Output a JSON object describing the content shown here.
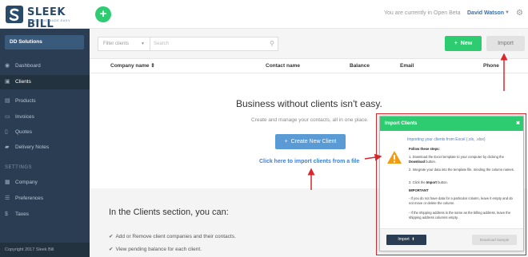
{
  "app": {
    "logo_text": "SLEEK BILL",
    "logo_tagline": "INVOICING MADE EASY",
    "beta_text": "You are currently in Open Beta",
    "user_name": "David Watson"
  },
  "sidebar": {
    "org_name": "DD Solutions",
    "items": [
      {
        "label": "Dashboard",
        "icon": "eye-icon",
        "active": false
      },
      {
        "label": "Clients",
        "icon": "clients-icon",
        "active": true
      },
      {
        "label": "Products",
        "icon": "box-icon",
        "active": false
      },
      {
        "label": "Invoices",
        "icon": "invoice-icon",
        "active": false
      },
      {
        "label": "Quotes",
        "icon": "quote-icon",
        "active": false
      },
      {
        "label": "Delivery Notes",
        "icon": "truck-icon",
        "active": false
      }
    ],
    "settings_heading": "SETTINGS",
    "settings_items": [
      {
        "label": "Company",
        "icon": "building-icon"
      },
      {
        "label": "Preferences",
        "icon": "sliders-icon"
      },
      {
        "label": "Taxes",
        "icon": "dollar-icon"
      }
    ],
    "copyright": "Copyright 2017 Sleek Bill"
  },
  "toolbar": {
    "filter_label": "Filter clients",
    "search_placeholder": "Search",
    "new_label": "New",
    "import_label": "Import"
  },
  "table": {
    "columns": [
      "Company name",
      "Contact name",
      "Balance",
      "Email",
      "Phone"
    ]
  },
  "empty_state": {
    "title": "Business without clients isn't easy.",
    "subtitle": "Create and manage your contacts, all in one place.",
    "create_label": "Create New Client",
    "import_link": "Click here to import clients from a file"
  },
  "info": {
    "title": "In the Clients section, you can:",
    "items": [
      "Add or Remove client companies and their contacts.",
      "View pending balance for each client."
    ]
  },
  "modal": {
    "title": "Import Clients",
    "subtitle": "Importing your clients from Excel (.xls, .xlsx)",
    "steps_heading": "Follow these steps:",
    "step1_pre": "1. Download the Excel template to your computer by clicking the ",
    "step1_bold": "Download",
    "step1_post": " button.",
    "step2": "2. Integrate your data into the template file, minding the column names.",
    "step3_pre": "3. Click the ",
    "step3_bold": "Import",
    "step3_post": " button.",
    "important_heading": "IMPORTANT",
    "note1": "- If you do not have data for a particular column, leave it empty and do not move or delete the column.",
    "note2": "- If the shipping address is the same as the billing address, leave the shipping address columns empty.",
    "import_label": "Import",
    "download_label": "Download Sample"
  },
  "colors": {
    "accent_green": "#2ecc71",
    "sidebar_bg": "#2a3d52",
    "link_blue": "#3a7fd5",
    "annotation_red": "#d9262c"
  }
}
